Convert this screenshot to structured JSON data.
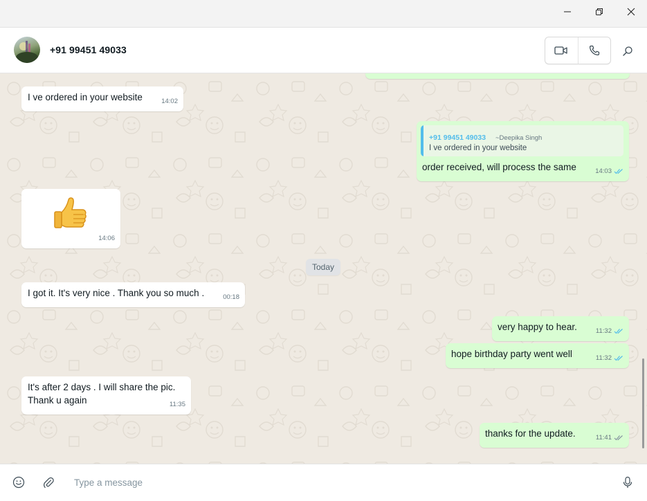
{
  "window": {
    "minimize_label": "",
    "maximize_label": "",
    "close_label": ""
  },
  "header": {
    "contact_name": "+91 99451 49033",
    "video_icon": "video-call-icon",
    "call_icon": "phone-icon",
    "search_icon": "search-icon"
  },
  "messages": [
    {
      "direction": "in",
      "text": "I ve ordered in your website",
      "time": "14:02"
    },
    {
      "direction": "out",
      "quote": {
        "sender": "+91 99451 49033",
        "alias": "~Deepika Singh",
        "text": "I ve ordered in your website"
      },
      "text": "order received, will process the same",
      "time": "14:03",
      "status": "read"
    },
    {
      "direction": "in",
      "sticker": "thumbs-up-emoji",
      "sticker_char": "👍",
      "time": "14:06"
    },
    {
      "direction": "in",
      "text": "I got it. It's very nice . Thank you so much .",
      "time": "00:18"
    },
    {
      "direction": "out",
      "text": "very happy to hear.",
      "time": "11:32",
      "status": "read"
    },
    {
      "direction": "out",
      "text": "hope birthday party went well",
      "time": "11:32",
      "status": "read"
    },
    {
      "direction": "in",
      "text": "It's after 2 days . I will share the pic.\nThank u again",
      "time": "11:35"
    },
    {
      "direction": "out",
      "text": "thanks for the update.",
      "time": "11:41",
      "status": "delivered"
    }
  ],
  "date_divider": "Today",
  "composer": {
    "placeholder": "Type a message",
    "value": ""
  },
  "colors": {
    "incoming_bubble": "#ffffff",
    "outgoing_bubble": "#d9fdd3",
    "read_tick": "#53bdeb",
    "delivered_tick": "#8696a0",
    "chat_background": "#efeae2"
  }
}
